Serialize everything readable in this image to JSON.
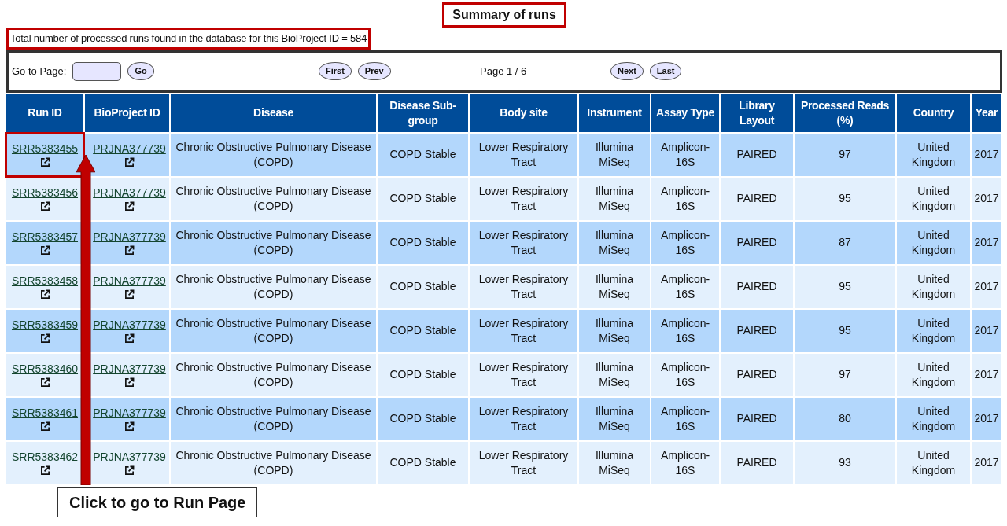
{
  "title": {
    "text": "Summary of runs",
    "highlighted": true
  },
  "total": {
    "text": "Total number of processed runs found in the database for this BioProject ID = 584",
    "highlighted": true
  },
  "pager": {
    "goto_label": "Go to Page:",
    "go": "Go",
    "first": "First",
    "prev": "Prev",
    "page_info": "Page 1 / 6",
    "next": "Next",
    "last": "Last"
  },
  "table": {
    "columns": [
      "Run ID",
      "BioProject ID",
      "Disease",
      "Disease Sub-group",
      "Body site",
      "Instrument",
      "Assay Type",
      "Library Layout",
      "Processed Reads (%)",
      "Country",
      "Year"
    ],
    "rows": [
      {
        "run_id": "SRR5383455",
        "highlighted": true,
        "bioproject": "PRJNA377739",
        "disease": "Chronic Obstructive Pulmonary Disease (COPD)",
        "subgroup": "COPD Stable",
        "body_site": "Lower Respiratory Tract",
        "instrument": "Illumina MiSeq",
        "assay": "Amplicon-16S",
        "layout": "PAIRED",
        "reads": "97",
        "country": "United Kingdom",
        "year": "2017"
      },
      {
        "run_id": "SRR5383456",
        "highlighted": false,
        "bioproject": "PRJNA377739",
        "disease": "Chronic Obstructive Pulmonary Disease (COPD)",
        "subgroup": "COPD Stable",
        "body_site": "Lower Respiratory Tract",
        "instrument": "Illumina MiSeq",
        "assay": "Amplicon-16S",
        "layout": "PAIRED",
        "reads": "95",
        "country": "United Kingdom",
        "year": "2017"
      },
      {
        "run_id": "SRR5383457",
        "highlighted": false,
        "bioproject": "PRJNA377739",
        "disease": "Chronic Obstructive Pulmonary Disease (COPD)",
        "subgroup": "COPD Stable",
        "body_site": "Lower Respiratory Tract",
        "instrument": "Illumina MiSeq",
        "assay": "Amplicon-16S",
        "layout": "PAIRED",
        "reads": "87",
        "country": "United Kingdom",
        "year": "2017"
      },
      {
        "run_id": "SRR5383458",
        "highlighted": false,
        "bioproject": "PRJNA377739",
        "disease": "Chronic Obstructive Pulmonary Disease (COPD)",
        "subgroup": "COPD Stable",
        "body_site": "Lower Respiratory Tract",
        "instrument": "Illumina MiSeq",
        "assay": "Amplicon-16S",
        "layout": "PAIRED",
        "reads": "95",
        "country": "United Kingdom",
        "year": "2017"
      },
      {
        "run_id": "SRR5383459",
        "highlighted": false,
        "bioproject": "PRJNA377739",
        "disease": "Chronic Obstructive Pulmonary Disease (COPD)",
        "subgroup": "COPD Stable",
        "body_site": "Lower Respiratory Tract",
        "instrument": "Illumina MiSeq",
        "assay": "Amplicon-16S",
        "layout": "PAIRED",
        "reads": "95",
        "country": "United Kingdom",
        "year": "2017"
      },
      {
        "run_id": "SRR5383460",
        "highlighted": false,
        "bioproject": "PRJNA377739",
        "disease": "Chronic Obstructive Pulmonary Disease (COPD)",
        "subgroup": "COPD Stable",
        "body_site": "Lower Respiratory Tract",
        "instrument": "Illumina MiSeq",
        "assay": "Amplicon-16S",
        "layout": "PAIRED",
        "reads": "97",
        "country": "United Kingdom",
        "year": "2017"
      },
      {
        "run_id": "SRR5383461",
        "highlighted": false,
        "bioproject": "PRJNA377739",
        "disease": "Chronic Obstructive Pulmonary Disease (COPD)",
        "subgroup": "COPD Stable",
        "body_site": "Lower Respiratory Tract",
        "instrument": "Illumina MiSeq",
        "assay": "Amplicon-16S",
        "layout": "PAIRED",
        "reads": "80",
        "country": "United Kingdom",
        "year": "2017"
      },
      {
        "run_id": "SRR5383462",
        "highlighted": false,
        "bioproject": "PRJNA377739",
        "disease": "Chronic Obstructive Pulmonary Disease (COPD)",
        "subgroup": "COPD Stable",
        "body_site": "Lower Respiratory Tract",
        "instrument": "Illumina MiSeq",
        "assay": "Amplicon-16S",
        "layout": "PAIRED",
        "reads": "93",
        "country": "United Kingdom",
        "year": "2017"
      }
    ]
  },
  "callout": {
    "text": "Click to go to Run Page"
  }
}
